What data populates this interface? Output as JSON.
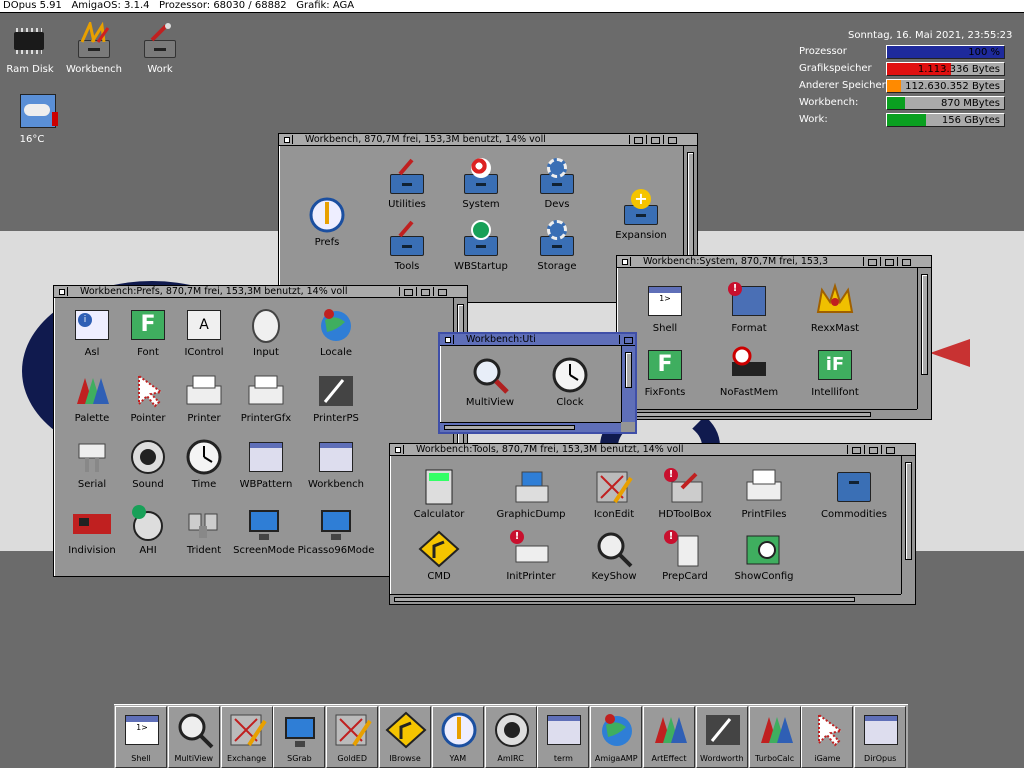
{
  "screen": {
    "title": "DOpus 5.91   AmigaOS: 3.1.4   Prozessor: 68030 / 68882   Grafik: AGA"
  },
  "desktop": {
    "icons": [
      {
        "label": "Ram Disk",
        "icon": "ram-chip-icon"
      },
      {
        "label": "Workbench",
        "icon": "workbench-disk-icon"
      },
      {
        "label": "Work",
        "icon": "work-disk-icon"
      },
      {
        "label": "16°C",
        "icon": "weather-icon"
      }
    ],
    "datetime": "Sonntag, 16. Mai 2021, 23:55:23",
    "meters": [
      {
        "label": "Prozessor",
        "value": "100 %",
        "fill": 1.0,
        "color": "#1e2a9c"
      },
      {
        "label": "Grafikspeicher",
        "value": "1.113.336 Bytes",
        "fill": 0.55,
        "color": "#e01010"
      },
      {
        "label": "Anderer Speicher",
        "value": "112.630.352 Bytes",
        "fill": 0.12,
        "color": "#ff8a00"
      },
      {
        "label": "Workbench:",
        "value": "870 MBytes",
        "fill": 0.15,
        "color": "#0aa020"
      },
      {
        "label": "Work:",
        "value": "156 GBytes",
        "fill": 0.33,
        "color": "#0aa020"
      }
    ]
  },
  "windows": {
    "workbench": {
      "title": "Workbench,  870,7M frei, 153,3M benutzt, 14% voll",
      "items": [
        "Prefs",
        "Utilities",
        "System",
        "Devs",
        "Expansion",
        "Tools",
        "WBStartup",
        "Storage"
      ]
    },
    "system": {
      "title": "Workbench:System,  870,7M frei, 153,3",
      "items": [
        "Shell",
        "Format",
        "RexxMast",
        "FixFonts",
        "NoFastMem",
        "Intellifont"
      ]
    },
    "prefs": {
      "title": "Workbench:Prefs,  870,7M frei, 153,3M benutzt, 14% voll",
      "items": [
        "Asl",
        "Font",
        "IControl",
        "Input",
        "Locale",
        "Palette",
        "Pointer",
        "Printer",
        "PrinterGfx",
        "PrinterPS",
        "Serial",
        "Sound",
        "Time",
        "WBPattern",
        "Workbench",
        "Indivision",
        "AHI",
        "Trident",
        "ScreenMode",
        "Picasso96Mode"
      ]
    },
    "utilities": {
      "title": "Workbench:Uti",
      "items": [
        "MultiView",
        "Clock"
      ]
    },
    "tools": {
      "title": "Workbench:Tools,  870,7M frei, 153,3M benutzt, 14% voll",
      "items": [
        "Calculator",
        "GraphicDump",
        "IconEdit",
        "HDToolBox",
        "PrintFiles",
        "Commodities",
        "CMD",
        "InitPrinter",
        "KeyShow",
        "PrepCard",
        "ShowConfig"
      ]
    }
  },
  "dock": {
    "items": [
      "Shell",
      "MultiView",
      "Exchange",
      "SGrab",
      "GoldED",
      "IBrowse",
      "YAM",
      "AmIRC",
      "term",
      "AmigaAMP",
      "ArtEffect",
      "Wordworth",
      "TurboCalc",
      "iGame",
      "DirOpus"
    ]
  }
}
